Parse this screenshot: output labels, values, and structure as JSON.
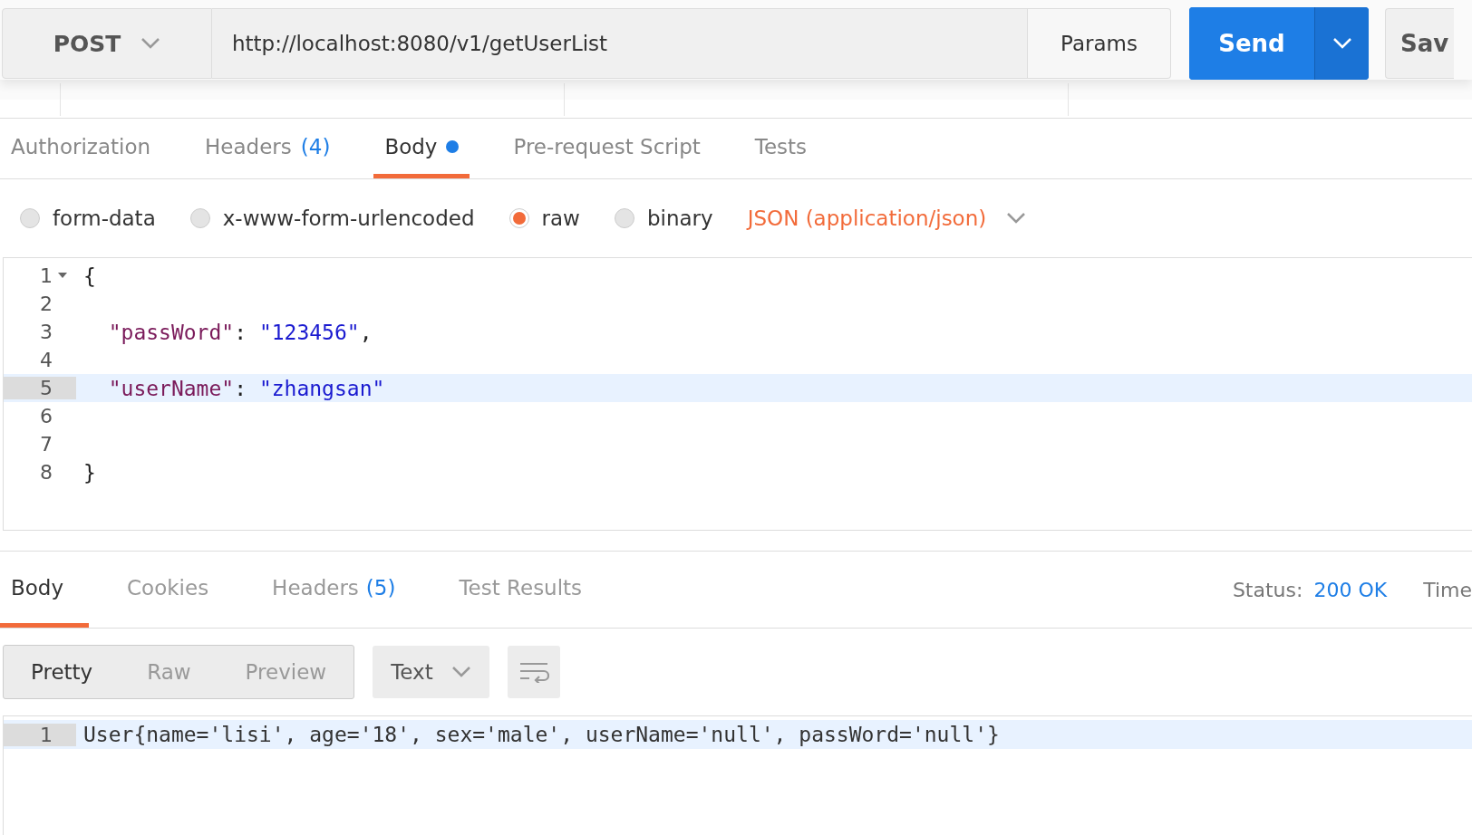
{
  "request": {
    "method": "POST",
    "url": "http://localhost:8080/v1/getUserList",
    "params_label": "Params",
    "send_label": "Send",
    "save_label": "Sav"
  },
  "request_tabs": [
    {
      "label": "Authorization",
      "selected": false,
      "dot": false
    },
    {
      "label": "Headers",
      "count": "(4)",
      "selected": false,
      "dot": false
    },
    {
      "label": "Body",
      "selected": true,
      "dot": true
    },
    {
      "label": "Pre-request Script",
      "selected": false,
      "dot": false
    },
    {
      "label": "Tests",
      "selected": false,
      "dot": false
    }
  ],
  "body_types": [
    {
      "label": "form-data",
      "selected": false
    },
    {
      "label": "x-www-form-urlencoded",
      "selected": false
    },
    {
      "label": "raw",
      "selected": true
    },
    {
      "label": "binary",
      "selected": false
    }
  ],
  "content_type": "JSON (application/json)",
  "request_body": [
    {
      "number": "1",
      "foldable": true,
      "active": false,
      "tokens": [
        {
          "kind": "punct",
          "text": "{"
        }
      ]
    },
    {
      "number": "2",
      "foldable": false,
      "active": false
    },
    {
      "number": "3",
      "foldable": false,
      "active": false,
      "tokens": [
        {
          "kind": "key",
          "text": "  \"passWord\""
        },
        {
          "kind": "punct",
          "text": ": "
        },
        {
          "kind": "string",
          "text": "\"123456\""
        },
        {
          "kind": "punct",
          "text": ","
        }
      ]
    },
    {
      "number": "4",
      "foldable": false,
      "active": false
    },
    {
      "number": "5",
      "foldable": false,
      "active": true,
      "tokens": [
        {
          "kind": "key",
          "text": "  \"userName\""
        },
        {
          "kind": "punct",
          "text": ": "
        },
        {
          "kind": "string",
          "text": "\"zhangsan\""
        }
      ]
    },
    {
      "number": "6",
      "foldable": false,
      "active": false
    },
    {
      "number": "7",
      "foldable": false,
      "active": false
    },
    {
      "number": "8",
      "foldable": false,
      "active": false,
      "tokens": [
        {
          "kind": "punct",
          "text": "}"
        }
      ]
    }
  ],
  "response_tabs": [
    {
      "label": "Body",
      "selected": true
    },
    {
      "label": "Cookies",
      "selected": false
    },
    {
      "label": "Headers",
      "count": "(5)",
      "selected": false
    },
    {
      "label": "Test Results",
      "selected": false
    }
  ],
  "status_label": "Status:",
  "status_value": "200 OK",
  "time_label": "Time",
  "view_modes": [
    {
      "label": "Pretty",
      "selected": true
    },
    {
      "label": "Raw",
      "selected": false
    },
    {
      "label": "Preview",
      "selected": false
    }
  ],
  "format": "Text",
  "response_body": [
    {
      "number": "1",
      "text": "User{name='lisi', age='18', sex='male', userName='null', passWord='null'}"
    }
  ]
}
